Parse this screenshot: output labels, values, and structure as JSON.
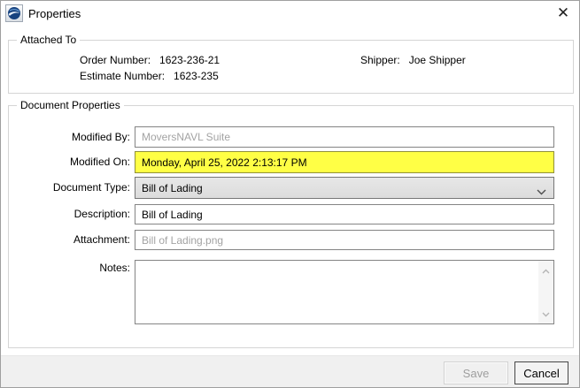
{
  "window": {
    "title": "Properties"
  },
  "icons": {
    "app_logo": "blue-swirl-logo",
    "close": "✕",
    "combo_chevron": "chevron-down",
    "notes_scroll_up": "chevron-up",
    "notes_scroll_down": "chevron-down"
  },
  "attached_to": {
    "legend": "Attached To",
    "order_number_label": "Order Number:",
    "order_number_value": "1623-236-21",
    "estimate_number_label": "Estimate Number:",
    "estimate_number_value": "1623-235",
    "shipper_label": "Shipper:",
    "shipper_value": "Joe Shipper"
  },
  "document_properties": {
    "legend": "Document Properties",
    "modified_by": {
      "label": "Modified By:",
      "value": "MoversNAVL Suite"
    },
    "modified_on": {
      "label": "Modified On:",
      "value": "Monday, April 25, 2022 2:13:17 PM",
      "highlight_color": "#ffff45"
    },
    "document_type": {
      "label": "Document Type:",
      "value": "Bill of Lading"
    },
    "description": {
      "label": "Description:",
      "value": "Bill of Lading"
    },
    "attachment": {
      "label": "Attachment:",
      "value": "Bill of Lading.png"
    },
    "notes": {
      "label": "Notes:",
      "value": ""
    }
  },
  "footer": {
    "save_label": "Save",
    "cancel_label": "Cancel"
  }
}
